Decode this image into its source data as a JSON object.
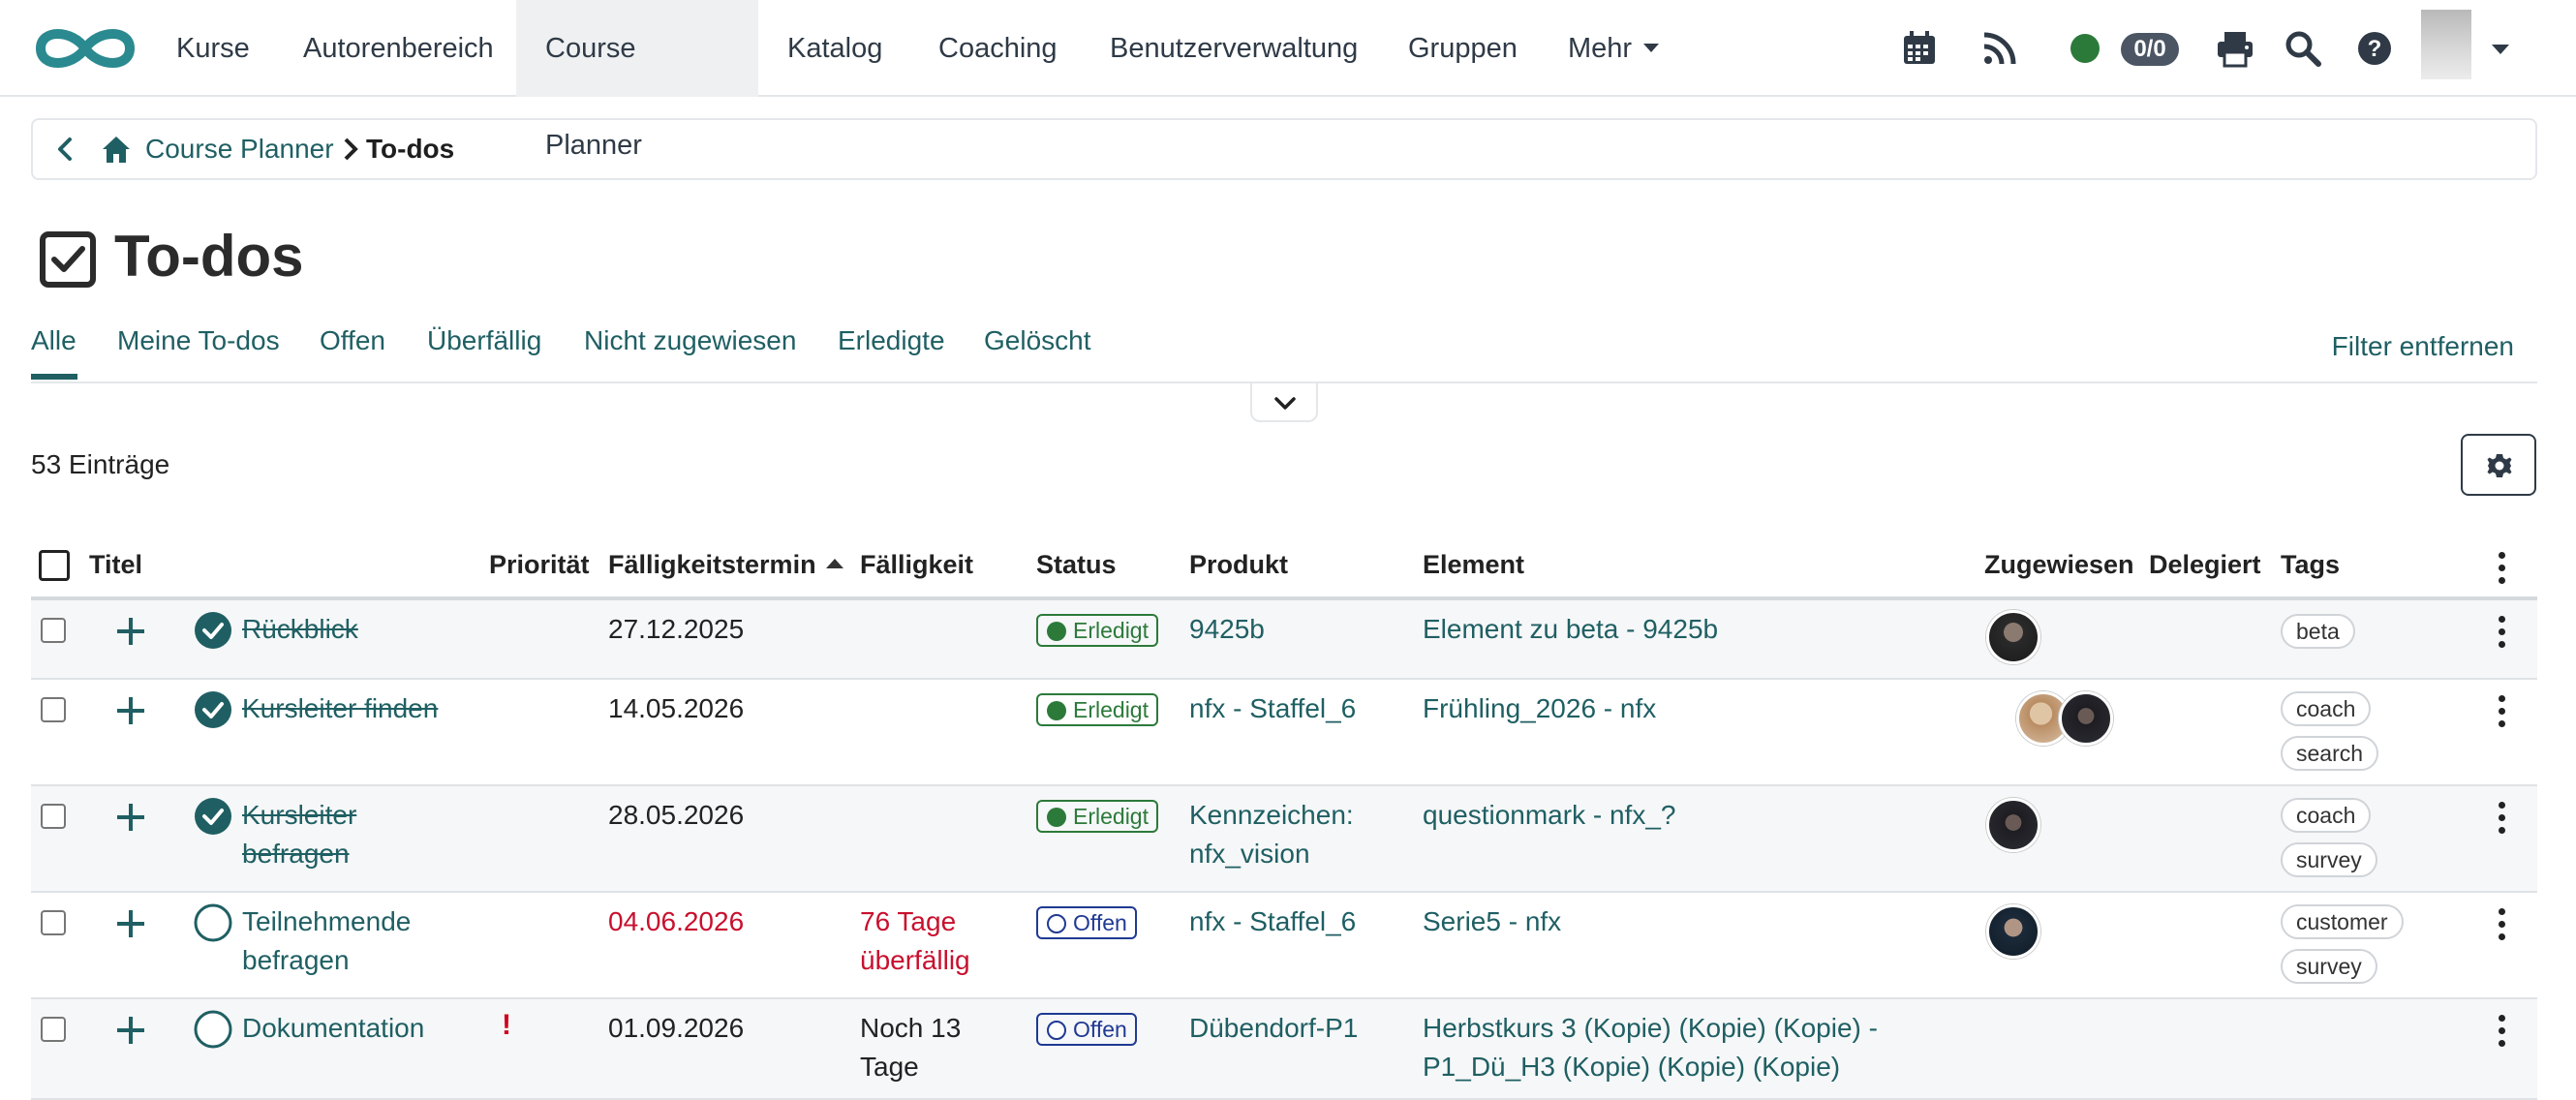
{
  "nav": {
    "items": [
      "Kurse",
      "Autorenbereich",
      "Course Planner",
      "Katalog",
      "Coaching",
      "Benutzerverwaltung",
      "Gruppen",
      "Mehr"
    ],
    "active": "Course Planner",
    "badge": "0/0",
    "icons": [
      "calendar-icon",
      "rss-icon",
      "online-status-icon",
      "print-icon",
      "search-icon",
      "help-icon",
      "user-avatar"
    ]
  },
  "breadcrumb": {
    "parent": "Course Planner",
    "current": "To-dos"
  },
  "page": {
    "title": "To-dos"
  },
  "tabs": {
    "items": [
      "Alle",
      "Meine To-dos",
      "Offen",
      "Überfällig",
      "Nicht zugewiesen",
      "Erledigte",
      "Gelöscht"
    ],
    "active": "Alle",
    "filter_remove": "Filter entfernen"
  },
  "list": {
    "count": "53 Einträge"
  },
  "table": {
    "headers": {
      "title": "Titel",
      "priority": "Priorität",
      "due_date": "Fälligkeitstermin",
      "due": "Fälligkeit",
      "status": "Status",
      "product": "Produkt",
      "element": "Element",
      "assigned": "Zugewiesen",
      "delegated": "Delegiert",
      "tags": "Tags"
    },
    "rows": [
      {
        "title": "Rückblick",
        "done": true,
        "priority": "",
        "due_date": "27.12.2025",
        "due": "",
        "status": "Erledigt",
        "product": "9425b",
        "element": "Element zu beta - 9425b",
        "tags": [
          "beta"
        ]
      },
      {
        "title": "Kursleiter finden",
        "done": true,
        "priority": "",
        "due_date": "14.05.2026",
        "due": "",
        "status": "Erledigt",
        "product": "nfx - Staffel_6",
        "element": "Frühling_2026 - nfx",
        "tags": [
          "coach",
          "search"
        ]
      },
      {
        "title_l1": "Kursleiter",
        "title_l2": "befragen",
        "done": true,
        "priority": "",
        "due_date": "28.05.2026",
        "due": "",
        "status": "Erledigt",
        "product_l1": "Kennzeichen:",
        "product_l2": "nfx_vision",
        "element": "questionmark - nfx_?",
        "tags": [
          "coach",
          "survey"
        ]
      },
      {
        "title_l1": "Teilnehmende",
        "title_l2": "befragen",
        "done": false,
        "priority": "",
        "due_date": "04.06.2026",
        "due_l1": "76 Tage",
        "due_l2": "überfällig",
        "status": "Offen",
        "product": "nfx - Staffel_6",
        "element": "Serie5 - nfx",
        "tags": [
          "customer",
          "survey"
        ]
      },
      {
        "title": "Dokumentation",
        "done": false,
        "priority": "!",
        "due_date": "01.09.2026",
        "due_l1": "Noch 13",
        "due_l2": "Tage",
        "status": "Offen",
        "product": "Dübendorf-P1",
        "element_l1": "Herbstkurs 3 (Kopie) (Kopie) (Kopie) -",
        "element_l2": "P1_Dü_H3 (Kopie) (Kopie) (Kopie)",
        "tags": []
      }
    ]
  },
  "colors": {
    "accent": "#1f5f63",
    "done": "#2c7a3a",
    "open": "#1f3a93",
    "late": "#c8102e"
  }
}
